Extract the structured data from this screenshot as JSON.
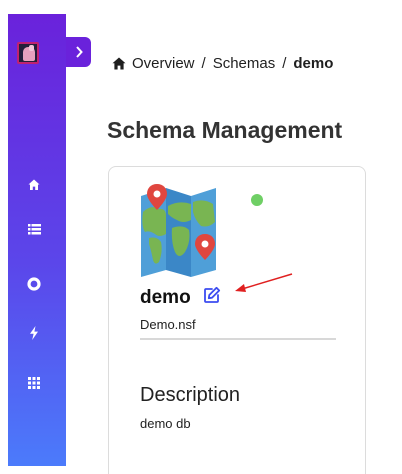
{
  "breadcrumb": {
    "items": [
      "Overview",
      "Schemas"
    ],
    "separator": "/",
    "current": "demo"
  },
  "page": {
    "title": "Schema Management"
  },
  "sidebar": {
    "logo_icon": "app-logo",
    "expand_icon": "chevron-right-icon",
    "items": [
      {
        "icon": "home-icon"
      },
      {
        "icon": "list-icon"
      },
      {
        "icon": "circle-icon"
      },
      {
        "icon": "lightning-icon"
      },
      {
        "icon": "grid-icon"
      }
    ],
    "colors": {
      "top": "#6a22db",
      "bottom": "#4b7bfb"
    }
  },
  "schema": {
    "icon": "world-map-icon",
    "status_color": "#6fcf65",
    "name": "demo",
    "file": "Demo.nsf",
    "description_label": "Description",
    "description": "demo db"
  },
  "annotation": {
    "arrow_color": "#e02020"
  }
}
